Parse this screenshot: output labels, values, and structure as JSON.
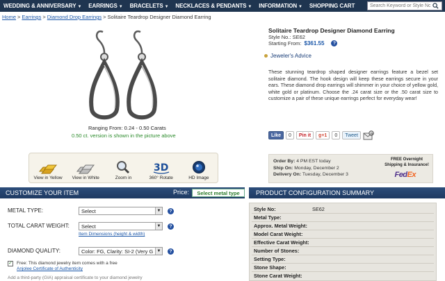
{
  "nav": {
    "items": [
      {
        "label": "WEDDING & ANNIVERSARY",
        "caret": "▼"
      },
      {
        "label": "EARRINGS",
        "caret": "▼"
      },
      {
        "label": "BRACELETS",
        "caret": "▼"
      },
      {
        "label": "NECKLACES & PENDANTS",
        "caret": "▼"
      },
      {
        "label": "INFORMATION",
        "caret": "▼"
      },
      {
        "label": "SHOPPING CART",
        "caret": ""
      }
    ],
    "search_placeholder": "Search Keyword or Style No."
  },
  "breadcrumb": {
    "home": "Home",
    "earrings": "Earrings",
    "drop": "Diamond Drop Earrings",
    "current": "Solitaire Teardrop Designer Diamond Earring",
    "sep": ">"
  },
  "product": {
    "range": "Ranging From: 0.24 - 0.50 Carats",
    "version_note": "0.50 ct. version is shown in the picture above",
    "title": "Solitaire Teardrop Designer Diamond Earring",
    "style_no": "Style No.: SE62",
    "starting_label": "Starting From:",
    "price": "$361.55",
    "advice": "Jeweler's Advice",
    "description": "These stunning teardrop shaped designer earrings feature a bezel set solitaire diamond. The hook design will keep these earrings secure in your ears. These diamond drop earrings will shimmer in your choice of yellow gold, white gold or platinum. Choose the .24 carat size or the .50 carat size to customize a pair of these unique earrings perfect for everyday wear!"
  },
  "social": {
    "like": "Like",
    "like_count": "0",
    "pin": "Pin it",
    "gplus": "g+1",
    "gplus_count": "0",
    "tweet": "Tweet"
  },
  "view_buttons": [
    {
      "label": "View in Yellow",
      "icon": "gold-bars-icon"
    },
    {
      "label": "View in White",
      "icon": "silver-bars-icon"
    },
    {
      "label": "Zoom in",
      "icon": "magnifier-icon"
    },
    {
      "label": "360° Rotate",
      "icon": "3d-icon"
    },
    {
      "label": "HD Image",
      "icon": "camera-lens-icon"
    }
  ],
  "order": {
    "order_by_label": "Order By:",
    "order_by": "4 PM EST today",
    "ship_label": "Ship On:",
    "ship": "Monday, December 2",
    "delivery_label": "Delivery On:",
    "delivery": "Tuesday, December 3",
    "free_shipping": "FREE Overnight Shipping & Insurance!",
    "fed": "Fed",
    "ex": "Ex"
  },
  "customize": {
    "title": "CUSTOMIZE YOUR ITEM",
    "price_label": "Price:",
    "price_value": "Select metal type",
    "metal_label": "METAL TYPE:",
    "metal_value": "Select",
    "carat_label": "TOTAL CARAT WEIGHT:",
    "carat_value": "Select",
    "dims_link": "Item Dimensions (height & width)",
    "quality_label": "DIAMOND QUALITY:",
    "quality_value": "Color: FG, Clarity: SI-2 (Very G",
    "free_line1": "Free: This diamond jewelry item comes with a free",
    "free_link": "Anjolee Certificate of Authenticity",
    "cut_row": "Add a third-party (GIA) appraisal certificate to your diamond jewelry"
  },
  "summary": {
    "title": "PRODUCT CONFIGURATION SUMMARY",
    "rows": [
      {
        "label": "Style No:",
        "value": "SE62"
      },
      {
        "label": "Metal Type:",
        "value": ""
      },
      {
        "label": "Approx. Metal Weight:",
        "value": ""
      },
      {
        "label": "Model Carat Weight:",
        "value": ""
      },
      {
        "label": "Effective Carat Weight:",
        "value": ""
      },
      {
        "label": "Number of Stones:",
        "value": ""
      },
      {
        "label": "Setting Type:",
        "value": ""
      },
      {
        "label": "Stone Shape:",
        "value": ""
      },
      {
        "label": "Stone Carat Weight:",
        "value": ""
      }
    ]
  },
  "colors": {
    "nav_bg": "#1f3550",
    "link": "#1a56a8",
    "green": "#2a8a2a",
    "header_bg": "#2c4d7a"
  }
}
